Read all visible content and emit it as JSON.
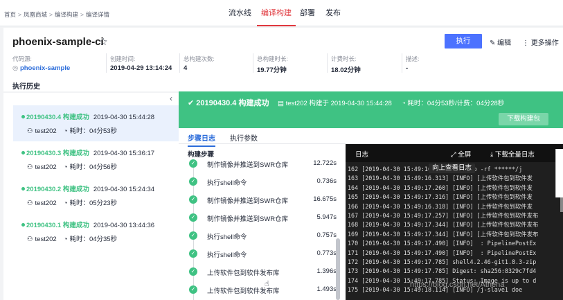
{
  "breadcrumb": {
    "items": [
      "首页",
      "凤凰商城",
      "编译构建",
      "编译详情"
    ],
    "separator": ">"
  },
  "nav": [
    {
      "label": "流水线",
      "active": false
    },
    {
      "label": "编译构建",
      "active": true
    },
    {
      "label": "部署",
      "active": false
    },
    {
      "label": "发布",
      "active": false
    }
  ],
  "job": {
    "name": "phoenix-sample-ci",
    "run_label": "执行",
    "edit_label": "编辑",
    "more_label": "更多操作"
  },
  "meta": [
    {
      "label": "代码源:",
      "value": "phoenix-sample"
    },
    {
      "label": "创建时间:",
      "value": "2019-04-29 13:14:24"
    },
    {
      "label": "总构建次数:",
      "value": "4"
    },
    {
      "label": "总构建时长:",
      "value": "19.77分钟"
    },
    {
      "label": "计费时长:",
      "value": "18.02分钟"
    },
    {
      "label": "描述:",
      "value": "-"
    }
  ],
  "history_tab": "执行历史",
  "history": [
    {
      "name": "20190430.4 构建成功",
      "date": "2019-04-30 15:44:28",
      "user": "test202",
      "duration": "耗时：04分53秒"
    },
    {
      "name": "20190430.3 构建成功",
      "date": "2019-04-30 15:36:17",
      "user": "test202",
      "duration": "耗时：04分56秒"
    },
    {
      "name": "20190430.2 构建成功",
      "date": "2019-04-30 15:24:34",
      "user": "test202",
      "duration": "耗时：05分23秒"
    },
    {
      "name": "20190430.1 构建成功",
      "date": "2019-04-30 13:44:36",
      "user": "test202",
      "duration": "耗时：04分35秒"
    }
  ],
  "banner": {
    "status": "20190430.4 构建成功",
    "builder": "test202 构建于 2019-04-30 15:44:28",
    "duration": "耗时：04分53秒/计费：04分28秒",
    "download_label": "下载构建包"
  },
  "tabs": [
    {
      "label": "步骤日志",
      "active": true
    },
    {
      "label": "执行参数",
      "active": false
    }
  ],
  "steps_title": "构建步骤",
  "steps": [
    {
      "name": "制作镜像并推送到SWR仓库",
      "duration": "12.722s"
    },
    {
      "name": "执行shell命令",
      "duration": "0.736s"
    },
    {
      "name": "制作镜像并推送到SWR仓库",
      "duration": "16.675s"
    },
    {
      "name": "制作镜像并推送到SWR仓库",
      "duration": "5.947s"
    },
    {
      "name": "执行shell命令",
      "duration": "0.757s"
    },
    {
      "name": "执行shell命令",
      "duration": "0.773s"
    },
    {
      "name": "上传软件包到软件发布库",
      "duration": "1.396s"
    },
    {
      "name": "上传软件包到软件发布库",
      "duration": "1.493s"
    }
  ],
  "log": {
    "title": "日志",
    "fullscreen_label": "全屏",
    "download_label": "下载全量日志",
    "scroll_hint": "向上查看日志",
    "lines": [
      "162 [2019-04-30 15:49:16.299] /bin/cp -rf ******/j",
      "163 [2019-04-30 15:49:16.313] [INFO] [上传软件包到软件发",
      "164 [2019-04-30 15:49:17.260] [INFO] [上传软件包到软件发",
      "165 [2019-04-30 15:49:17.316] [INFO] [上传软件包到软件发",
      "166 [2019-04-30 15:49:16.318] [INFO] [上传软件包到软件发",
      "167 [2019-04-30 15:49:17.257] [INFO] [上传软件包到软件发布",
      "168 [2019-04-30 15:49:17.344] [INFO] [上传软件包到软件发布",
      "169 [2019-04-30 15:49:17.344] [INFO] [上传软件包到软件发布",
      "170 [2019-04-30 15:49:17.490] [INFO]  : PipelinePostEx",
      "171 [2019-04-30 15:49:17.490] [INFO]  : PipelinePostEx",
      "172 [2019-04-30 15:49:17.785] shell4.2.46-git1.8.3-zip",
      "173 [2019-04-30 15:49:17.785] Digest: sha256:8329c7fd4",
      "174 [2019-04-30 15:49:17.785] Status: Image is up to d",
      "175 [2019-04-30 15:49:18.114] [INFO] /j-slave1 doe"
    ]
  },
  "watermark": "https://blog.csdn.net/Athena"
}
